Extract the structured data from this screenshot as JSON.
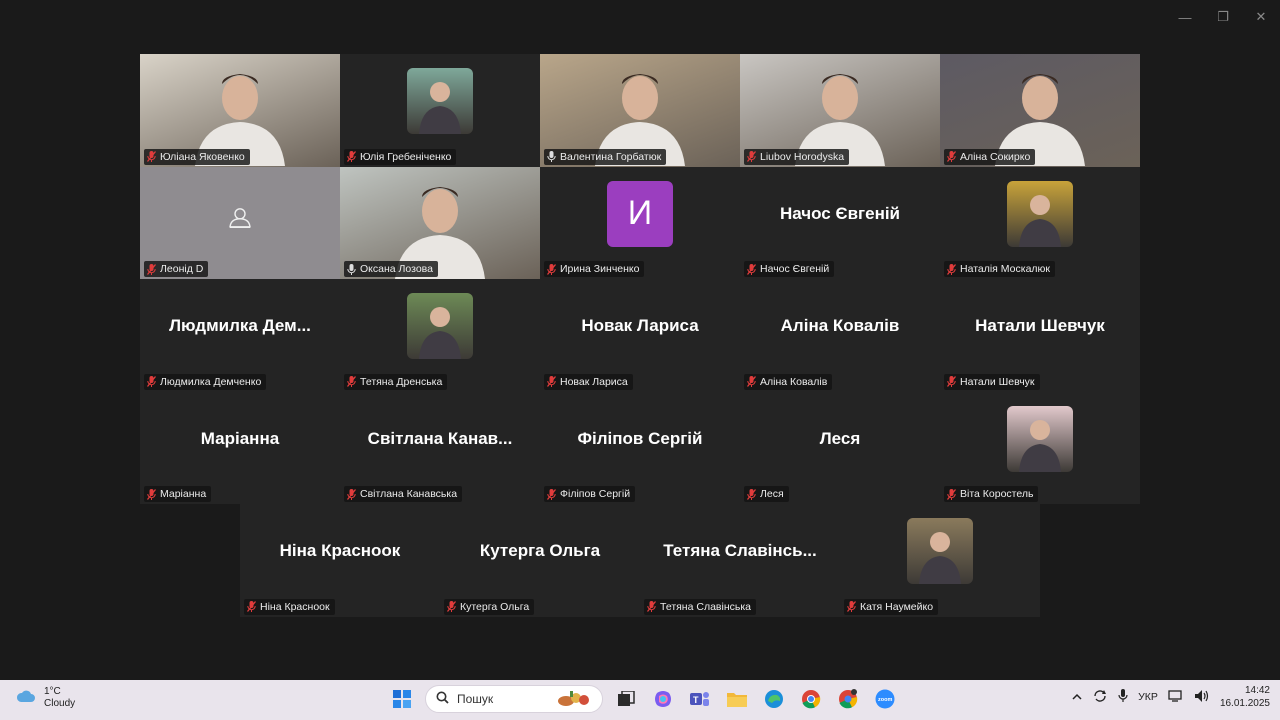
{
  "window_controls": {
    "minimize": "—",
    "restore": "❐",
    "close": "✕"
  },
  "participants_grid": [
    {
      "name": "Юліана Яковенко",
      "type": "video",
      "bg": "#d9d3c8",
      "muted": true
    },
    {
      "name": "Юлія Гребеніченко",
      "type": "photo",
      "bg": "#7fa89a",
      "muted": true
    },
    {
      "name": "Валентина Горбатюк",
      "type": "video",
      "bg": "#b9a68a",
      "muted": false,
      "active": true
    },
    {
      "name": "Liubov Horodyska",
      "type": "video",
      "bg": "#c9c6c2",
      "muted": true
    },
    {
      "name": "Аліна Сокирко",
      "type": "video",
      "bg": "#5d5a63",
      "muted": true
    },
    {
      "name": "Леонід D",
      "type": "icon",
      "bg": "#8f8c90",
      "muted": true
    },
    {
      "name": "Оксана Лозова",
      "type": "video",
      "bg": "#bfc4c0",
      "muted": false
    },
    {
      "name": "Ирина Зинченко",
      "type": "initial",
      "initial": "И",
      "muted": true
    },
    {
      "name": "Начос Євгеній",
      "display": "Начос Євгеній",
      "type": "text",
      "muted": true
    },
    {
      "name": "Наталія Москалюк",
      "type": "photo",
      "bg": "#c8a33a",
      "muted": true
    },
    {
      "name": "Людмилка Демченко",
      "display": "Людмилка  Дем...",
      "type": "text",
      "muted": true
    },
    {
      "name": "Тетяна Дренська",
      "type": "photo",
      "bg": "#6d8a56",
      "muted": true
    },
    {
      "name": "Новак Лариса",
      "display": "Новак Лариса",
      "type": "text",
      "muted": true
    },
    {
      "name": "Аліна Ковалів",
      "display": "Аліна Ковалів",
      "type": "text",
      "muted": true
    },
    {
      "name": "Натали Шевчук",
      "display": "Натали Шевчук",
      "type": "text",
      "muted": true
    },
    {
      "name": "Маріанна",
      "display": "Маріанна",
      "type": "text",
      "muted": true
    },
    {
      "name": "Світлана Канавська",
      "display": "Світлана  Канав...",
      "type": "text",
      "muted": true
    },
    {
      "name": "Філіпов Сергій",
      "display": "Філіпов Сергій",
      "type": "text",
      "muted": true
    },
    {
      "name": "Леся",
      "display": "Леся",
      "type": "text",
      "muted": true
    },
    {
      "name": "Віта Коростель",
      "type": "photo",
      "bg": "#e2c9cc",
      "muted": true
    }
  ],
  "participants_last_row": [
    {
      "name": "Ніна Краснокок",
      "label": "Ніна Краснoок",
      "display": "Ніна Краснoок",
      "type": "text",
      "muted": true
    },
    {
      "name": "Кутерга Ольга",
      "label": "Кутерга Ольга",
      "display": "Кутерга Ольга",
      "type": "text",
      "muted": true
    },
    {
      "name": "Тетяна Славінська",
      "label": "Тетяна Славінська",
      "display": "Тетяна  Славінсь...",
      "type": "text",
      "muted": true
    },
    {
      "name": "Катя Наумейко",
      "label": "Катя Наумейко",
      "type": "photo",
      "bg": "#8a7a5c",
      "muted": true
    }
  ],
  "taskbar": {
    "weather_temp": "1°C",
    "weather_desc": "Cloudy",
    "search_placeholder": "Пошук",
    "lang": "УКР",
    "time": "14:42",
    "date": "16.01.2025"
  },
  "colors": {
    "active_border": "#2ecc71",
    "muted_mic": "#e03c3c",
    "initial_bg": "#9b3ebf"
  }
}
